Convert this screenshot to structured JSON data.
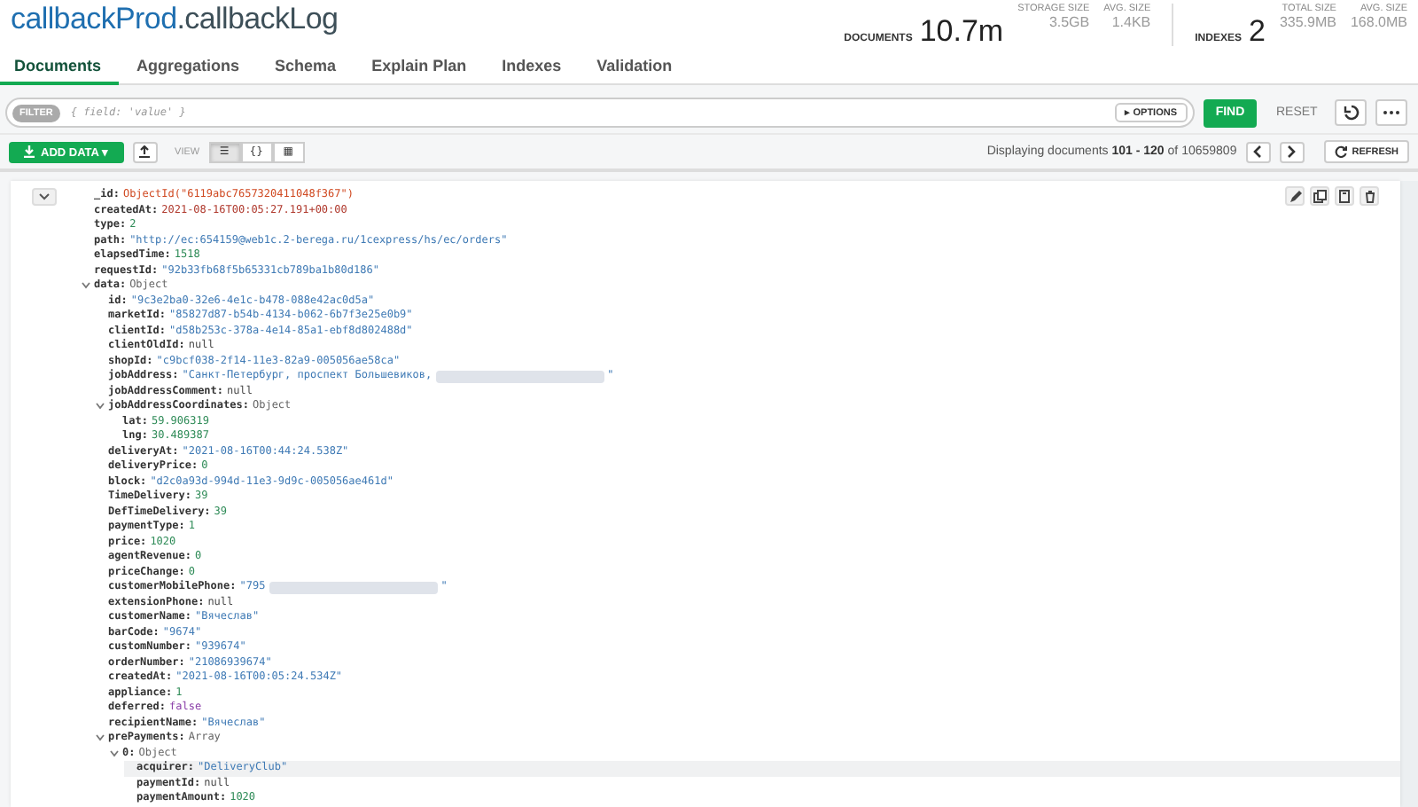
{
  "header": {
    "database": "callbackProd",
    "collection": ".callbackLog",
    "stats": [
      {
        "label": "DOCUMENTS",
        "value": "10.7m",
        "kind": "big"
      },
      {
        "label": "STORAGE SIZE",
        "value": "3.5GB",
        "kind": "small"
      },
      {
        "label": "AVG. SIZE",
        "value": "1.4KB",
        "kind": "small"
      },
      {
        "label": "INDEXES",
        "value": "2",
        "kind": "big"
      },
      {
        "label": "TOTAL SIZE",
        "value": "335.9MB",
        "kind": "small"
      },
      {
        "label": "AVG. SIZE",
        "value": "168.0MB",
        "kind": "small"
      }
    ]
  },
  "tabs": [
    {
      "label": "Documents",
      "selected": true
    },
    {
      "label": "Aggregations",
      "selected": false
    },
    {
      "label": "Schema",
      "selected": false
    },
    {
      "label": "Explain Plan",
      "selected": false
    },
    {
      "label": "Indexes",
      "selected": false
    },
    {
      "label": "Validation",
      "selected": false
    }
  ],
  "filter": {
    "badge": "FILTER",
    "placeholder": "{ field: 'value' }",
    "options": "▸ OPTIONS",
    "find": "FIND",
    "reset": "RESET"
  },
  "toolbar": {
    "add_data": "ADD DATA ▾",
    "view_label": "VIEW",
    "views": [
      {
        "glyph": "☰",
        "selected": true
      },
      {
        "glyph": "{}",
        "selected": false
      },
      {
        "glyph": "▦",
        "selected": false
      }
    ],
    "paging_text": "Displaying documents **101 - 120** of 10659809",
    "refresh": "REFRESH"
  },
  "document": {
    "expanded": true,
    "fields": [
      {
        "key": "_id:",
        "value": "ObjectId(\"6119abc7657320411048f367\")",
        "kind": "id"
      },
      {
        "key": "createdAt:",
        "value": "2021-08-16T00:05:27.191+00:00",
        "kind": "date"
      },
      {
        "key": "type:",
        "value": "2",
        "kind": "number"
      },
      {
        "key": "path:",
        "value": "\"http://ec:654159@web1c.2-berega.ru/1cexpress/hs/ec/orders\"",
        "kind": "string"
      },
      {
        "key": "elapsedTime:",
        "value": "1518",
        "kind": "number"
      },
      {
        "key": "requestId:",
        "value": "\"92b33fb68f5b65331cb789ba1b80d186\"",
        "kind": "string"
      },
      {
        "key": "data:",
        "value": "Object",
        "kind": "object",
        "expanded": true,
        "children": [
          {
            "key": "id:",
            "value": "\"9c3e2ba0-32e6-4e1c-b478-088e42ac0d5a\"",
            "kind": "string"
          },
          {
            "key": "marketId:",
            "value": "\"85827d87-b54b-4134-b062-6b7f3e25e0b9\"",
            "kind": "string"
          },
          {
            "key": "clientId:",
            "value": "\"d58b253c-378a-4e14-85a1-ebf8d802488d\"",
            "kind": "string"
          },
          {
            "key": "clientOldId:",
            "value": "null",
            "kind": "null"
          },
          {
            "key": "shopId:",
            "value": "\"c9bcf038-2f14-11e3-82a9-005056ae58ca\"",
            "kind": "string"
          },
          {
            "key": "jobAddress:",
            "value": "\"Санкт-Петербург, проспект Большевиков, ",
            "kind": "string",
            "redacted": true,
            "value_end": "\""
          },
          {
            "key": "jobAddressComment:",
            "value": "null",
            "kind": "null"
          },
          {
            "key": "jobAddressCoordinates:",
            "value": "Object",
            "kind": "object",
            "expanded": true,
            "children": [
              {
                "key": "lat:",
                "value": "59.906319",
                "kind": "number"
              },
              {
                "key": "lng:",
                "value": "30.489387",
                "kind": "number"
              }
            ]
          },
          {
            "key": "deliveryAt:",
            "value": "\"2021-08-16T00:44:24.538Z\"",
            "kind": "string"
          },
          {
            "key": "deliveryPrice:",
            "value": "0",
            "kind": "number"
          },
          {
            "key": "block:",
            "value": "\"d2c0a93d-994d-11e3-9d9c-005056ae461d\"",
            "kind": "string"
          },
          {
            "key": "TimeDelivery:",
            "value": "39",
            "kind": "number"
          },
          {
            "key": "DefTimeDelivery:",
            "value": "39",
            "kind": "number"
          },
          {
            "key": "paymentType:",
            "value": "1",
            "kind": "number"
          },
          {
            "key": "price:",
            "value": "1020",
            "kind": "number"
          },
          {
            "key": "agentRevenue:",
            "value": "0",
            "kind": "number"
          },
          {
            "key": "priceChange:",
            "value": "0",
            "kind": "number"
          },
          {
            "key": "customerMobilePhone:",
            "value": "\"795",
            "kind": "string",
            "redacted": true,
            "value_end": "\""
          },
          {
            "key": "extensionPhone:",
            "value": "null",
            "kind": "null"
          },
          {
            "key": "customerName:",
            "value": "\"Вячеслав\"",
            "kind": "string"
          },
          {
            "key": "barCode:",
            "value": "\"9674\"",
            "kind": "string"
          },
          {
            "key": "customNumber:",
            "value": "\"939674\"",
            "kind": "string"
          },
          {
            "key": "orderNumber:",
            "value": "\"21086939674\"",
            "kind": "string"
          },
          {
            "key": "createdAt:",
            "value": "\"2021-08-16T00:05:24.534Z\"",
            "kind": "string"
          },
          {
            "key": "appliance:",
            "value": "1",
            "kind": "number"
          },
          {
            "key": "deferred:",
            "value": "false",
            "kind": "bool"
          },
          {
            "key": "recipientName:",
            "value": "\"Вячеслав\"",
            "kind": "string"
          },
          {
            "key": "prePayments:",
            "value": "Array",
            "kind": "object",
            "expanded": true,
            "children": [
              {
                "key": "0:",
                "value": "Object",
                "kind": "object",
                "expanded": true,
                "children": [
                  {
                    "key": "acquirer:",
                    "value": "\"DeliveryClub\"",
                    "kind": "string",
                    "highlighted": true
                  },
                  {
                    "key": "paymentId:",
                    "value": "null",
                    "kind": "null"
                  },
                  {
                    "key": "paymentAmount:",
                    "value": "1020",
                    "kind": "number"
                  }
                ]
              }
            ]
          }
        ]
      }
    ]
  }
}
